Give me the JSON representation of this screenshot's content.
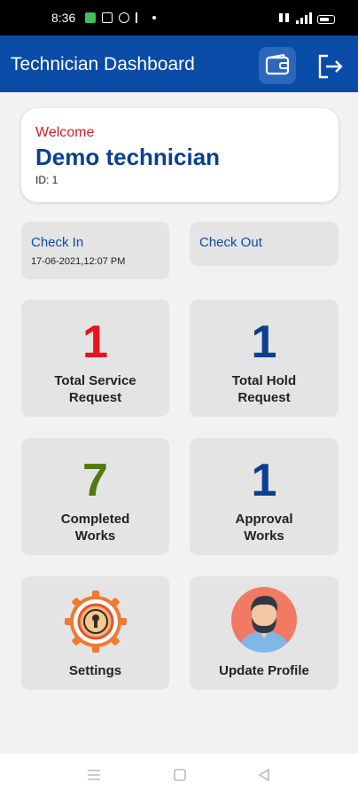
{
  "status_bar": {
    "time": "8:36"
  },
  "app_bar": {
    "title": "Technician Dashboard",
    "wallet_icon": "wallet-icon",
    "logout_icon": "logout-icon"
  },
  "welcome": {
    "greeting": "Welcome",
    "name": "Demo technician",
    "id_text": "ID: 1"
  },
  "check_in": {
    "label": "Check In",
    "time": "17-06-2021,12:07 PM"
  },
  "check_out": {
    "label": "Check Out"
  },
  "tiles": [
    {
      "count": "1",
      "line1": "Total Service",
      "line2": "Request",
      "color": "#e8131b"
    },
    {
      "count": "1",
      "line1": "Total Hold",
      "line2": "Request",
      "color": "#0b3f8f"
    },
    {
      "count": "7",
      "line1": "Completed",
      "line2": "Works",
      "color": "#4e7a10"
    },
    {
      "count": "1",
      "line1": "Approval",
      "line2": "Works",
      "color": "#0b3f8f"
    }
  ],
  "settings": {
    "label": "Settings",
    "icon": "settings-gear-icon"
  },
  "profile": {
    "label": "Update Profile",
    "icon": "avatar-icon"
  },
  "colors": {
    "app_bar": "#0a4ba8",
    "accent_red": "#d32020",
    "primary_blue": "#0b3f8f"
  }
}
